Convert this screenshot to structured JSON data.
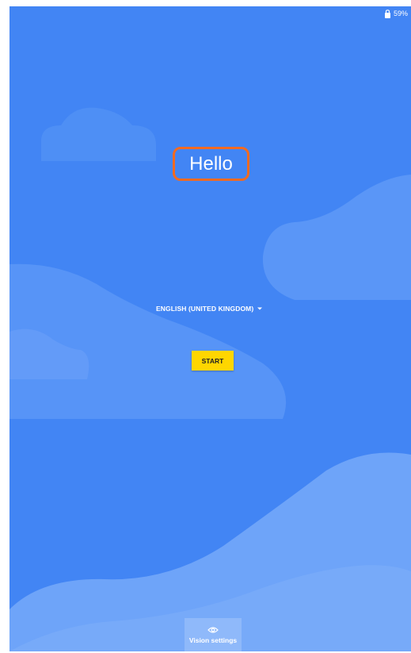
{
  "status_bar": {
    "battery_icon": "battery-lock-icon",
    "battery_percent": "59%"
  },
  "welcome": {
    "title": "Hello",
    "highlight_color": "#f26a21"
  },
  "language": {
    "selected": "ENGLISH (UNITED KINGDOM)",
    "icon": "dropdown-arrow-icon"
  },
  "start_button": {
    "label": "START",
    "color": "#ffd600"
  },
  "vision_settings": {
    "label": "Vision settings",
    "icon": "eye-icon"
  },
  "colors": {
    "background": "#4285f4",
    "cloud": "#5a95f6"
  }
}
